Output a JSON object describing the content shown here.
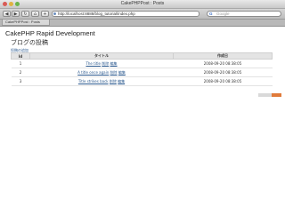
{
  "window": {
    "title": "CakePHPPost : Posts"
  },
  "toolbar": {
    "back": "◀",
    "forward": "▶",
    "reload": "↻",
    "home": "⌂",
    "add": "+",
    "url": "http://localhost:8888/blog_tutorial/index.php",
    "search_placeholder": "Google",
    "search_glyph": "G"
  },
  "tab": {
    "label": "CakePHPPost : Posts"
  },
  "page": {
    "site_title": "CakePHP Rapid Development",
    "heading": "ブログの投稿",
    "add_link": "投稿の追加"
  },
  "table": {
    "headers": [
      "Id",
      "タイトル",
      "作成日"
    ],
    "rows": [
      {
        "id": "1",
        "title": "The title",
        "delete": "削除",
        "edit": "編集",
        "created": "2008-09-20 08:38:05"
      },
      {
        "id": "2",
        "title": "A title once again",
        "delete": "削除",
        "edit": "編集",
        "created": "2008-09-20 08:38:05"
      },
      {
        "id": "3",
        "title": "Title strikes back",
        "delete": "削除",
        "edit": "編集",
        "created": "2008-09-20 08:38:05"
      }
    ]
  },
  "colors": {
    "link": "#2c5a8f",
    "sql_accent": "#e07a3a"
  }
}
